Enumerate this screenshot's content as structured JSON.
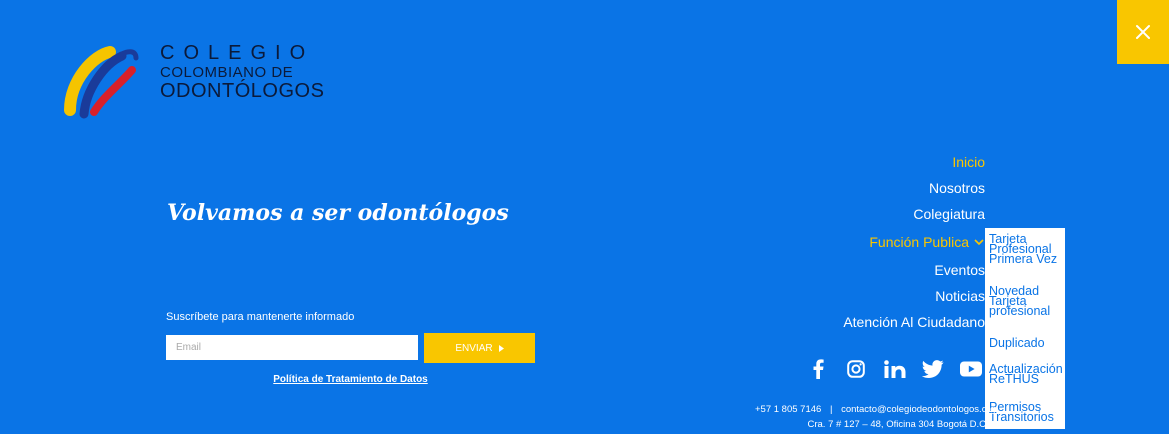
{
  "logo": {
    "line1": "COLEGIO",
    "line2": "COLOMBIANO DE",
    "line3": "ODONTÓLOGOS"
  },
  "close": {
    "icon": "close-icon"
  },
  "hero": {
    "slogan": "Volvamos a ser odontólogos"
  },
  "newsletter": {
    "label": "Suscríbete para mantenerte informado",
    "email_placeholder": "Email",
    "email_value": "",
    "button_label": "ENVIAR",
    "policy_link": "Política de Tratamiento de Datos"
  },
  "nav": {
    "items": [
      {
        "label": "Inicio"
      },
      {
        "label": "Nosotros"
      },
      {
        "label": "Colegiatura"
      },
      {
        "label": "Función Publica"
      },
      {
        "label": "Eventos"
      },
      {
        "label": "Noticias"
      },
      {
        "label": "Atención Al Ciudadano"
      }
    ],
    "active": "Inicio"
  },
  "dropdown": {
    "items": [
      {
        "lines": [
          "Tarjeta",
          "Profesional",
          "Primera Vez"
        ]
      },
      {
        "lines": [
          "Novedad",
          "Tarjeta",
          "profesional"
        ]
      },
      {
        "lines": [
          "Duplicado"
        ]
      },
      {
        "lines": [
          "Actualización",
          "ReTHUS"
        ]
      },
      {
        "lines": [
          "Permisos",
          "Transitorios"
        ]
      }
    ]
  },
  "social": [
    "facebook-icon",
    "instagram-icon",
    "linkedin-icon",
    "twitter-icon",
    "youtube-icon"
  ],
  "footer": {
    "phone": "+57 1 805 7146",
    "separator": "|",
    "email": "contacto@colegiodeodontologos.org",
    "address": "Cra. 7 # 127 – 48, Oficina 304 Bogotá D.C"
  },
  "colors": {
    "background": "#0a74e6",
    "accent": "#f9c600",
    "text": "#ffffff"
  }
}
